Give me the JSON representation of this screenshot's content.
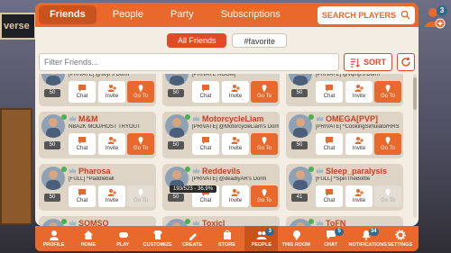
{
  "scene": {
    "sign_text": "verse"
  },
  "corner": {
    "badge": "3"
  },
  "tabs": [
    {
      "label": "Friends",
      "active": true
    },
    {
      "label": "People",
      "active": false
    },
    {
      "label": "Party",
      "active": false
    },
    {
      "label": "Subscriptions",
      "active": false
    }
  ],
  "search_players_label": "SEARCH PLAYERS",
  "filters": {
    "all_label": "All Friends",
    "favorite_label": "#favorite"
  },
  "filter_input": {
    "placeholder": "Filter Friends..."
  },
  "sort_label": "SORT",
  "actions": {
    "chat": "Chat",
    "invite": "Invite",
    "goto": "Go To"
  },
  "friends": [
    {
      "name": "",
      "status": "[PRIVATE] @svyr's Dorm",
      "level": "50"
    },
    {
      "name": "",
      "status": "[PRIVATE ROOM]",
      "level": "50"
    },
    {
      "name": "",
      "status": "[PRIVATE] @vqmp's Dorm",
      "level": "50"
    },
    {
      "name": "M&M",
      "status": "NBA2K MOD/HOST TRYOUT",
      "level": "50"
    },
    {
      "name": "MotorcycleLiam",
      "status": "[PRIVATE] @MotorcycleLiam's Dorm",
      "level": "50"
    },
    {
      "name": "OMEGA[PVP]",
      "status": "[PRIVATE] ^CookingSimulatorRRS",
      "level": "50"
    },
    {
      "name": "Pharosa",
      "status": "[FULL] ^Paddleball",
      "level": "50"
    },
    {
      "name": "Reddevils",
      "status": "[PRIVATE] @deadlyAR's Dorm",
      "level": "50",
      "tooltip": "193/523 - 36.9%"
    },
    {
      "name": "Sleep_paralysis",
      "status": "[FULL] ^SpinTheBottle",
      "level": "41"
    },
    {
      "name": "SOMSO",
      "status": "",
      "level": ""
    },
    {
      "name": "Toxicl",
      "status": "",
      "level": ""
    },
    {
      "name": "ToFN",
      "status": "",
      "level": ""
    }
  ],
  "bottom_nav": [
    {
      "label": "PROFILE",
      "icon": "profile-icon"
    },
    {
      "label": "HOME",
      "icon": "home-icon"
    },
    {
      "label": "PLAY",
      "icon": "gamepad-icon"
    },
    {
      "label": "CUSTOMIZE",
      "icon": "customize-icon"
    },
    {
      "label": "CREATE",
      "icon": "create-icon"
    },
    {
      "label": "STORE",
      "icon": "store-icon"
    },
    {
      "label": "PEOPLE",
      "icon": "people-icon",
      "badge": "3",
      "active": true
    },
    {
      "label": "THIS ROOM",
      "icon": "room-icon"
    },
    {
      "label": "CHAT",
      "icon": "chat-icon",
      "badge": "5"
    },
    {
      "label": "NOTIFICATIONS",
      "icon": "bell-icon",
      "badge": "34"
    },
    {
      "label": "SETTINGS",
      "icon": "gear-icon"
    }
  ],
  "colors": {
    "accent": "#e8692b",
    "dark_accent": "#c8531d",
    "name_red": "#c7401f",
    "panel": "#f3ede3"
  }
}
